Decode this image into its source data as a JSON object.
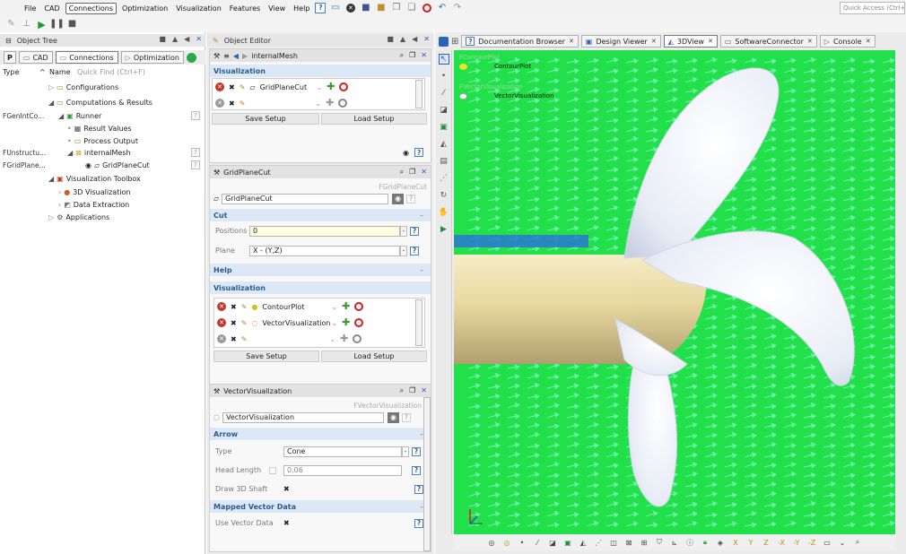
{
  "menubar": {
    "items": [
      "File",
      "CAD",
      "Connections",
      "Optimization",
      "Visualization",
      "Features",
      "View",
      "Help"
    ],
    "active": "Connections",
    "quick_access_placeholder": "Quick Access (Ctrl+"
  },
  "object_tree": {
    "title": "Object Tree",
    "tabs": [
      "CAD",
      "Connections",
      "Optimization"
    ],
    "selected_tab": "Connections",
    "col_type": "Type",
    "col_name": "Name",
    "quick_find_placeholder": "Quick Find (Ctrl+F)",
    "items": [
      {
        "type": "",
        "label": "Configurations",
        "level": 1
      },
      {
        "type": "",
        "label": "Computations & Results",
        "level": 1
      },
      {
        "type": "FGenIntCo...",
        "label": "Runner",
        "level": 2
      },
      {
        "type": "",
        "label": "Result Values",
        "level": 3
      },
      {
        "type": "",
        "label": "Process Output",
        "level": 3
      },
      {
        "type": "FUnstructu...",
        "label": "internalMesh",
        "level": 3
      },
      {
        "type": "FGridPlane...",
        "label": "GridPlaneCut",
        "level": 4
      },
      {
        "type": "",
        "label": "Visualization Toolbox",
        "level": 1
      },
      {
        "type": "",
        "label": "3D Visualization",
        "level": 2
      },
      {
        "type": "",
        "label": "Data Extraction",
        "level": 2
      },
      {
        "type": "",
        "label": "Applications",
        "level": 1
      }
    ]
  },
  "object_editor": {
    "title": "Object Editor",
    "mesh_panel": {
      "title": "internalMesh",
      "section_visualization": "Visualization",
      "vis_item": "GridPlaneCut",
      "save": "Save Setup",
      "load": "Load Setup"
    },
    "cut_panel": {
      "title": "GridPlaneCut",
      "class": "FGridPlaneCut",
      "name_value": "GridPlaneCut",
      "section_cut": "Cut",
      "positions_label": "Positions",
      "positions_value": "0",
      "plane_label": "Plane",
      "plane_value": "X - (Y,Z)",
      "section_help": "Help",
      "section_visualization": "Visualization",
      "vis_items": [
        "ContourPlot",
        "VectorVisualization"
      ],
      "save": "Save Setup",
      "load": "Load Setup"
    },
    "vector_panel": {
      "title": "VectorVisualization",
      "class": "FVectorVisualization",
      "name_value": "VectorVisualization",
      "section_arrow": "Arrow",
      "type_label": "Type",
      "type_value": "Cone",
      "head_length_label": "Head Length",
      "head_length_value": "0.06",
      "draw_shaft_label": "Draw 3D Shaft",
      "draw_shaft_value": "✖",
      "section_mapped": "Mapped Vector Data",
      "use_vector_label": "Use Vector Data",
      "use_vector_value": "✖"
    }
  },
  "view_tabs": {
    "items": [
      "Documentation Browser",
      "Design Viewer",
      "3DView",
      "SoftwareConnector",
      "Console"
    ],
    "selected": "3DView"
  },
  "view3d": {
    "legend": [
      {
        "class": "FContourPlot",
        "name": "ContourPlot"
      },
      {
        "class": "FVectorVisualization",
        "name": "VectorVisualization"
      }
    ],
    "colors": {
      "flow": "#22e04a",
      "arrows": "#7ff5c0",
      "blade": "#eef0f8",
      "hub": "#e8dcaa"
    }
  }
}
